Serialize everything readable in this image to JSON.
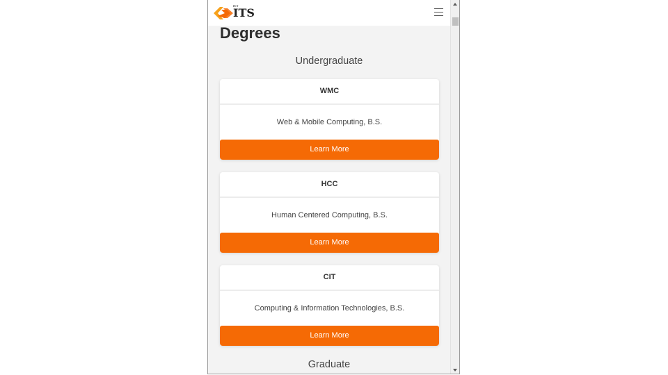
{
  "brand": {
    "small_text": "RIT",
    "name": "ITS",
    "accent_color": "#f56a05",
    "logo_icon": "its-logo-icon",
    "menu_icon": "hamburger-menu-icon"
  },
  "page": {
    "title": "Degrees"
  },
  "sections": [
    {
      "heading": "Undergraduate"
    },
    {
      "heading": "Graduate"
    }
  ],
  "cards": [
    {
      "code": "WMC",
      "name": "Web & Mobile Computing, B.S.",
      "button_label": "Learn More"
    },
    {
      "code": "HCC",
      "name": "Human Centered Computing, B.S.",
      "button_label": "Learn More"
    },
    {
      "code": "CIT",
      "name": "Computing & Information Technologies, B.S.",
      "button_label": "Learn More"
    }
  ]
}
